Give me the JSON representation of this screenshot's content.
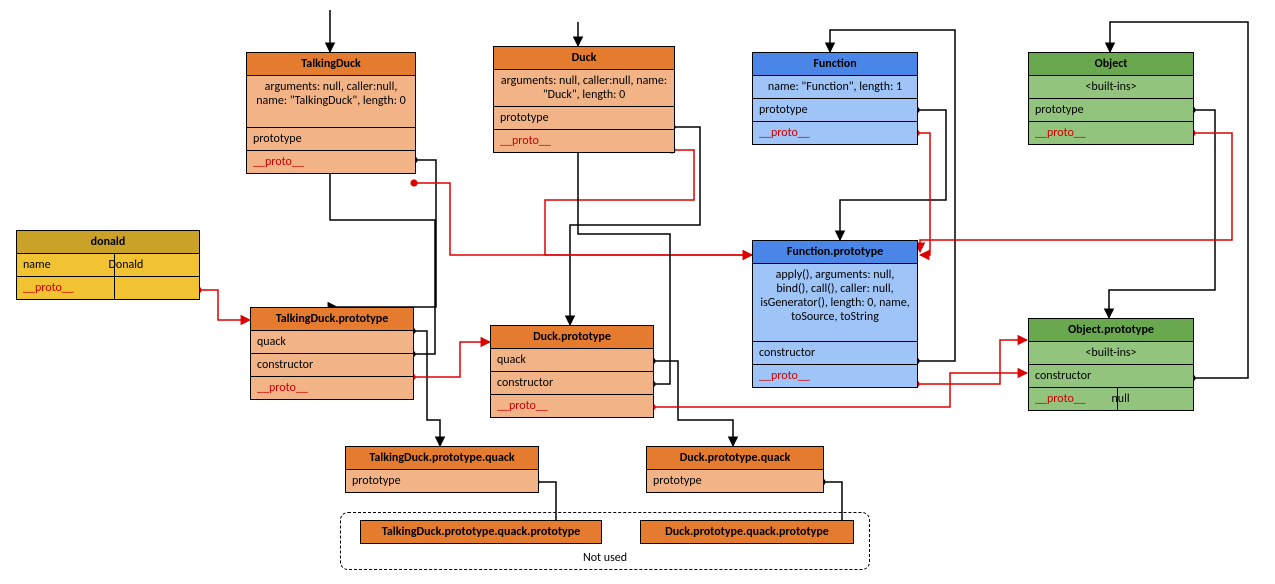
{
  "boxes": {
    "donald": {
      "title": "donald",
      "rows": [
        {
          "cells": [
            "name",
            "Donald"
          ]
        },
        {
          "cells": [
            "__proto__",
            ""
          ],
          "proto_idx": 0
        }
      ]
    },
    "TalkingDuck": {
      "title": "TalkingDuck",
      "rows": [
        {
          "text": "arguments: null, caller:null, name: \"TalkingDuck\", length: 0",
          "multi": true
        },
        {
          "text": "prototype"
        },
        {
          "text": "__proto__",
          "proto": true
        }
      ]
    },
    "TalkingDuckProto": {
      "title": "TalkingDuck.prototype",
      "rows": [
        {
          "text": "quack"
        },
        {
          "text": "constructor"
        },
        {
          "text": "__proto__",
          "proto": true
        }
      ]
    },
    "TalkingDuckQuack": {
      "title": "TalkingDuck.prototype.quack",
      "rows": [
        {
          "text": "prototype"
        }
      ]
    },
    "TalkingDuckQuackProto": {
      "title": "TalkingDuck.prototype.quack.prototype"
    },
    "Duck": {
      "title": "Duck",
      "rows": [
        {
          "text": "arguments: null, caller:null, name: \"Duck\", length: 0",
          "multi": true
        },
        {
          "text": "prototype"
        },
        {
          "text": "__proto__",
          "proto": true
        }
      ]
    },
    "DuckProto": {
      "title": "Duck.prototype",
      "rows": [
        {
          "text": "quack"
        },
        {
          "text": "constructor"
        },
        {
          "text": "__proto__",
          "proto": true
        }
      ]
    },
    "DuckQuack": {
      "title": "Duck.prototype.quack",
      "rows": [
        {
          "text": "prototype"
        }
      ]
    },
    "DuckQuackProto": {
      "title": "Duck.prototype.quack.prototype"
    },
    "Function": {
      "title": "Function",
      "rows": [
        {
          "text": "name: \"Function\", length: 1"
        },
        {
          "text": "prototype"
        },
        {
          "text": "__proto__",
          "proto": true
        }
      ]
    },
    "FunctionProto": {
      "title": "Function.prototype",
      "rows": [
        {
          "text": "apply(), arguments: null, bind(), call(), caller: null, isGenerator(), length: 0, name, toSource, toString",
          "multi": true
        },
        {
          "text": "constructor"
        },
        {
          "text": "__proto__",
          "proto": true
        }
      ]
    },
    "Object": {
      "title": "Object",
      "rows": [
        {
          "text": "<built-ins>"
        },
        {
          "text": "prototype"
        },
        {
          "text": "__proto__",
          "proto": true
        }
      ]
    },
    "ObjectProto": {
      "title": "Object.prototype",
      "rows": [
        {
          "text": "<built-ins>"
        },
        {
          "text": "constructor"
        },
        {
          "cells": [
            "__proto__",
            "null"
          ],
          "proto_idx": 0
        }
      ]
    }
  },
  "labels": {
    "not_used": "Not used"
  }
}
